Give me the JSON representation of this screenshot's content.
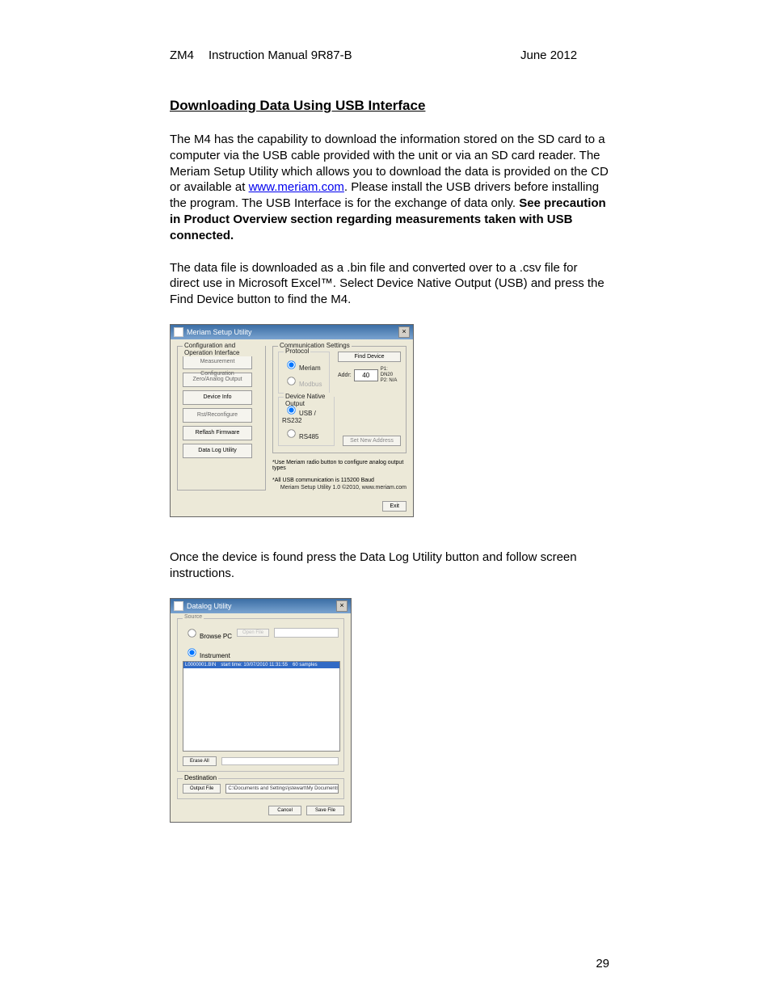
{
  "header": {
    "zm4": "ZM4",
    "manual": "Instruction Manual 9R87-B",
    "date": "June 2012"
  },
  "section_title": "Downloading Data Using USB Interface",
  "para1_a": "The M4 has the capability to download the information stored on the SD card to a computer via the USB cable provided with the unit or via an SD card reader. The Meriam Setup Utility which allows you to download the data is provided on the CD or available at ",
  "link_text": "www.meriam.com",
  "para1_b": ". Please install the USB drivers before installing the program. The USB Interface is for the exchange of data only. ",
  "para1_bold": "See precaution in Product Overview section regarding measurements taken with USB connected.",
  "para2": "The data file is downloaded as a .bin file and converted over to a .csv file for direct use in Microsoft Excel™.  Select Device Native Output (USB) and press the Find Device button to find the M4.",
  "setup": {
    "title": "Meriam Setup Utility",
    "left_group": "Configuration and Operation Interface",
    "btns": {
      "measure": "Measurement Configuration",
      "zero": "Zero/Analog Output",
      "devinfo": "Device Info",
      "rst": "Rst/Reconfigure",
      "reflash": "Reflash Firmware",
      "datalog": "Data Log Utility"
    },
    "comm_group": "Communication Settings",
    "protocol_group": "Protocol",
    "proto_meriam": "Meriam",
    "proto_modbus": "Modbus",
    "find_device": "Find Device",
    "addr_label": "Addr:",
    "addr_value": "40",
    "p1": "P1: DN20",
    "p2": "P2: N/A",
    "native_group": "Device Native Output",
    "native_usb": "USB / RS232",
    "native_rs485": "RS485",
    "set_addr": "Set New Address",
    "note1": "*Use Meriam radio button to configure analog output types",
    "note2": "*All USB communication is 115200 Baud",
    "copy": "Meriam Setup Utility 1.0 ©2010, www.meriam.com",
    "exit": "Exit"
  },
  "para3": "Once the device is found press the Data Log Utility button and follow screen instructions.",
  "datalog": {
    "title": "Datalog Utility",
    "source": "Source",
    "browse_pc": "Browse PC",
    "open_file": "Open File",
    "instrument": "Instrument",
    "row_file": "L0000001.BIN",
    "row_time": "start time: 10/07/2010 11:31:55",
    "row_samples": "60 samples",
    "erase": "Erase All",
    "destination": "Destination",
    "output_file": "Output File",
    "dest_path": "C:\\Documents and Settings\\jstewart\\My Documents\\Output.csv",
    "cancel": "Cancel",
    "save": "Save File"
  },
  "page_num": "29"
}
